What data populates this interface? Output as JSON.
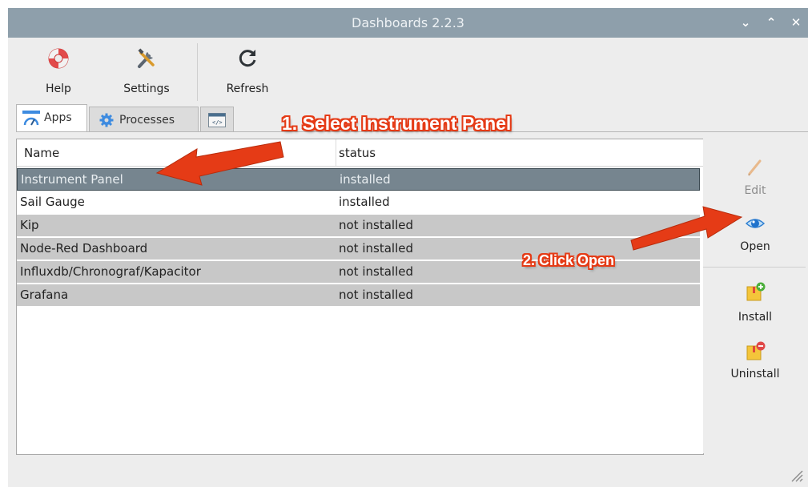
{
  "window": {
    "title": "Dashboards 2.2.3",
    "controls": {
      "minimize": "⌄",
      "maximize": "⌃",
      "close": "✕"
    }
  },
  "toolbar": {
    "help_label": "Help",
    "settings_label": "Settings",
    "refresh_label": "Refresh"
  },
  "tabs": [
    {
      "label": "Apps",
      "icon": "gauge-icon",
      "active": true
    },
    {
      "label": "Processes",
      "icon": "gear-icon",
      "active": false
    },
    {
      "label": "",
      "icon": "code-window-icon",
      "active": false
    }
  ],
  "table": {
    "columns": [
      "Name",
      "status"
    ],
    "rows": [
      {
        "name": "Instrument Panel",
        "status": "installed",
        "selected": true
      },
      {
        "name": "Sail Gauge",
        "status": "installed",
        "selected": false
      },
      {
        "name": "Kip",
        "status": "not installed",
        "selected": false
      },
      {
        "name": "Node-Red Dashboard",
        "status": "not installed",
        "selected": false
      },
      {
        "name": "Influxdb/Chronograf/Kapacitor",
        "status": "not installed",
        "selected": false
      },
      {
        "name": "Grafana",
        "status": "not installed",
        "selected": false
      }
    ]
  },
  "side_actions": {
    "edit_label": "Edit",
    "open_label": "Open",
    "install_label": "Install",
    "uninstall_label": "Uninstall"
  },
  "annotations": {
    "step1": "1. Select Instrument Panel",
    "step2": "2. Click Open"
  },
  "colors": {
    "titlebar": "#8e9fab",
    "selection": "#76858f",
    "row_alt": "#c8c8c8",
    "callout": "#e53b16"
  }
}
